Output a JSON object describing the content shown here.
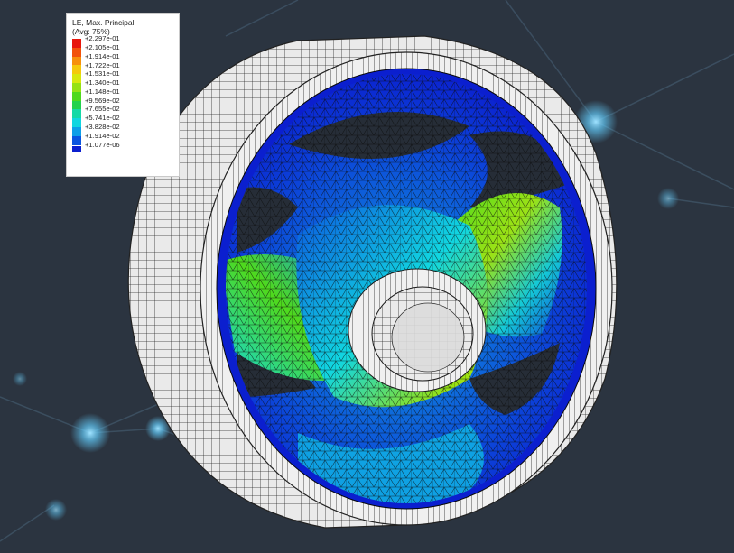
{
  "legend": {
    "title": "LE, Max. Principal",
    "average": "(Avg: 75%)",
    "values": [
      "+2.297e-01",
      "+2.105e-01",
      "+1.914e-01",
      "+1.722e-01",
      "+1.531e-01",
      "+1.340e-01",
      "+1.148e-01",
      "+9.569e-02",
      "+7.655e-02",
      "+5.741e-02",
      "+3.828e-02",
      "+1.914e-02",
      "+1.077e-06"
    ],
    "colors": [
      "#e8160c",
      "#f2520a",
      "#f7900b",
      "#f5c90c",
      "#d8e80e",
      "#96e214",
      "#4fd91c",
      "#22d24e",
      "#15d9a6",
      "#11d6e0",
      "#0e9fe8",
      "#0a55e0",
      "#0b1fcf"
    ]
  },
  "scene": {
    "background_color": "#2b3440",
    "node_color": "#5fc3f0",
    "mesh_line_color": "#1a1a1a",
    "tire_color": "#e9e9e9"
  }
}
